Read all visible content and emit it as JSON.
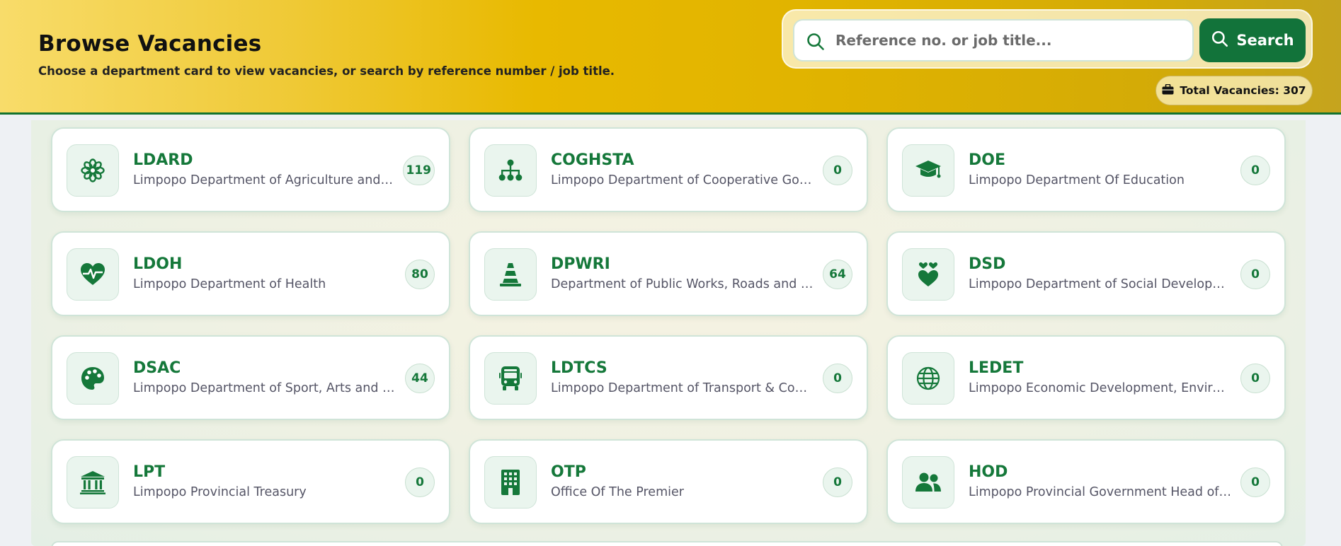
{
  "header": {
    "title": "Browse Vacancies",
    "subtitle": "Choose a department card to view vacancies, or search by reference number / job title.",
    "search": {
      "placeholder": "Reference no. or job title...",
      "value": "",
      "button_label": "Search"
    },
    "total_vacancies": "Total Vacancies: 307"
  },
  "colors": {
    "accent_green": "#15783a",
    "header_yellow": "#e8b900"
  },
  "departments": [
    {
      "abbr": "LDARD",
      "name": "Limpopo Department of Agriculture and Rural Development",
      "count": "119",
      "icon": "flower-icon"
    },
    {
      "abbr": "COGHSTA",
      "name": "Limpopo Department of Cooperative Governance, Human Settlements and Traditional Affairs",
      "count": "0",
      "icon": "sitemap-icon"
    },
    {
      "abbr": "DOE",
      "name": "Limpopo Department Of Education",
      "count": "0",
      "icon": "graduation-cap-icon"
    },
    {
      "abbr": "LDOH",
      "name": "Limpopo Department of Health",
      "count": "80",
      "icon": "heart-pulse-icon"
    },
    {
      "abbr": "DPWRI",
      "name": "Department of Public Works, Roads and Infrastructure",
      "count": "64",
      "icon": "traffic-cone-icon"
    },
    {
      "abbr": "DSD",
      "name": "Limpopo Department of Social Development",
      "count": "0",
      "icon": "hand-holding-heart-icon"
    },
    {
      "abbr": "DSAC",
      "name": "Limpopo Department of Sport, Arts and Culture",
      "count": "44",
      "icon": "palette-icon"
    },
    {
      "abbr": "LDTCS",
      "name": "Limpopo Department of Transport & Community Safety",
      "count": "0",
      "icon": "bus-icon"
    },
    {
      "abbr": "LEDET",
      "name": "Limpopo Economic Development, Environment and Tourism",
      "count": "0",
      "icon": "globe-icon"
    },
    {
      "abbr": "LPT",
      "name": "Limpopo Provincial Treasury",
      "count": "0",
      "icon": "bank-icon"
    },
    {
      "abbr": "OTP",
      "name": "Office Of The Premier",
      "count": "0",
      "icon": "building-icon"
    },
    {
      "abbr": "HOD",
      "name": "Limpopo Provincial Government Head of Departments",
      "count": "0",
      "icon": "users-icon"
    }
  ]
}
